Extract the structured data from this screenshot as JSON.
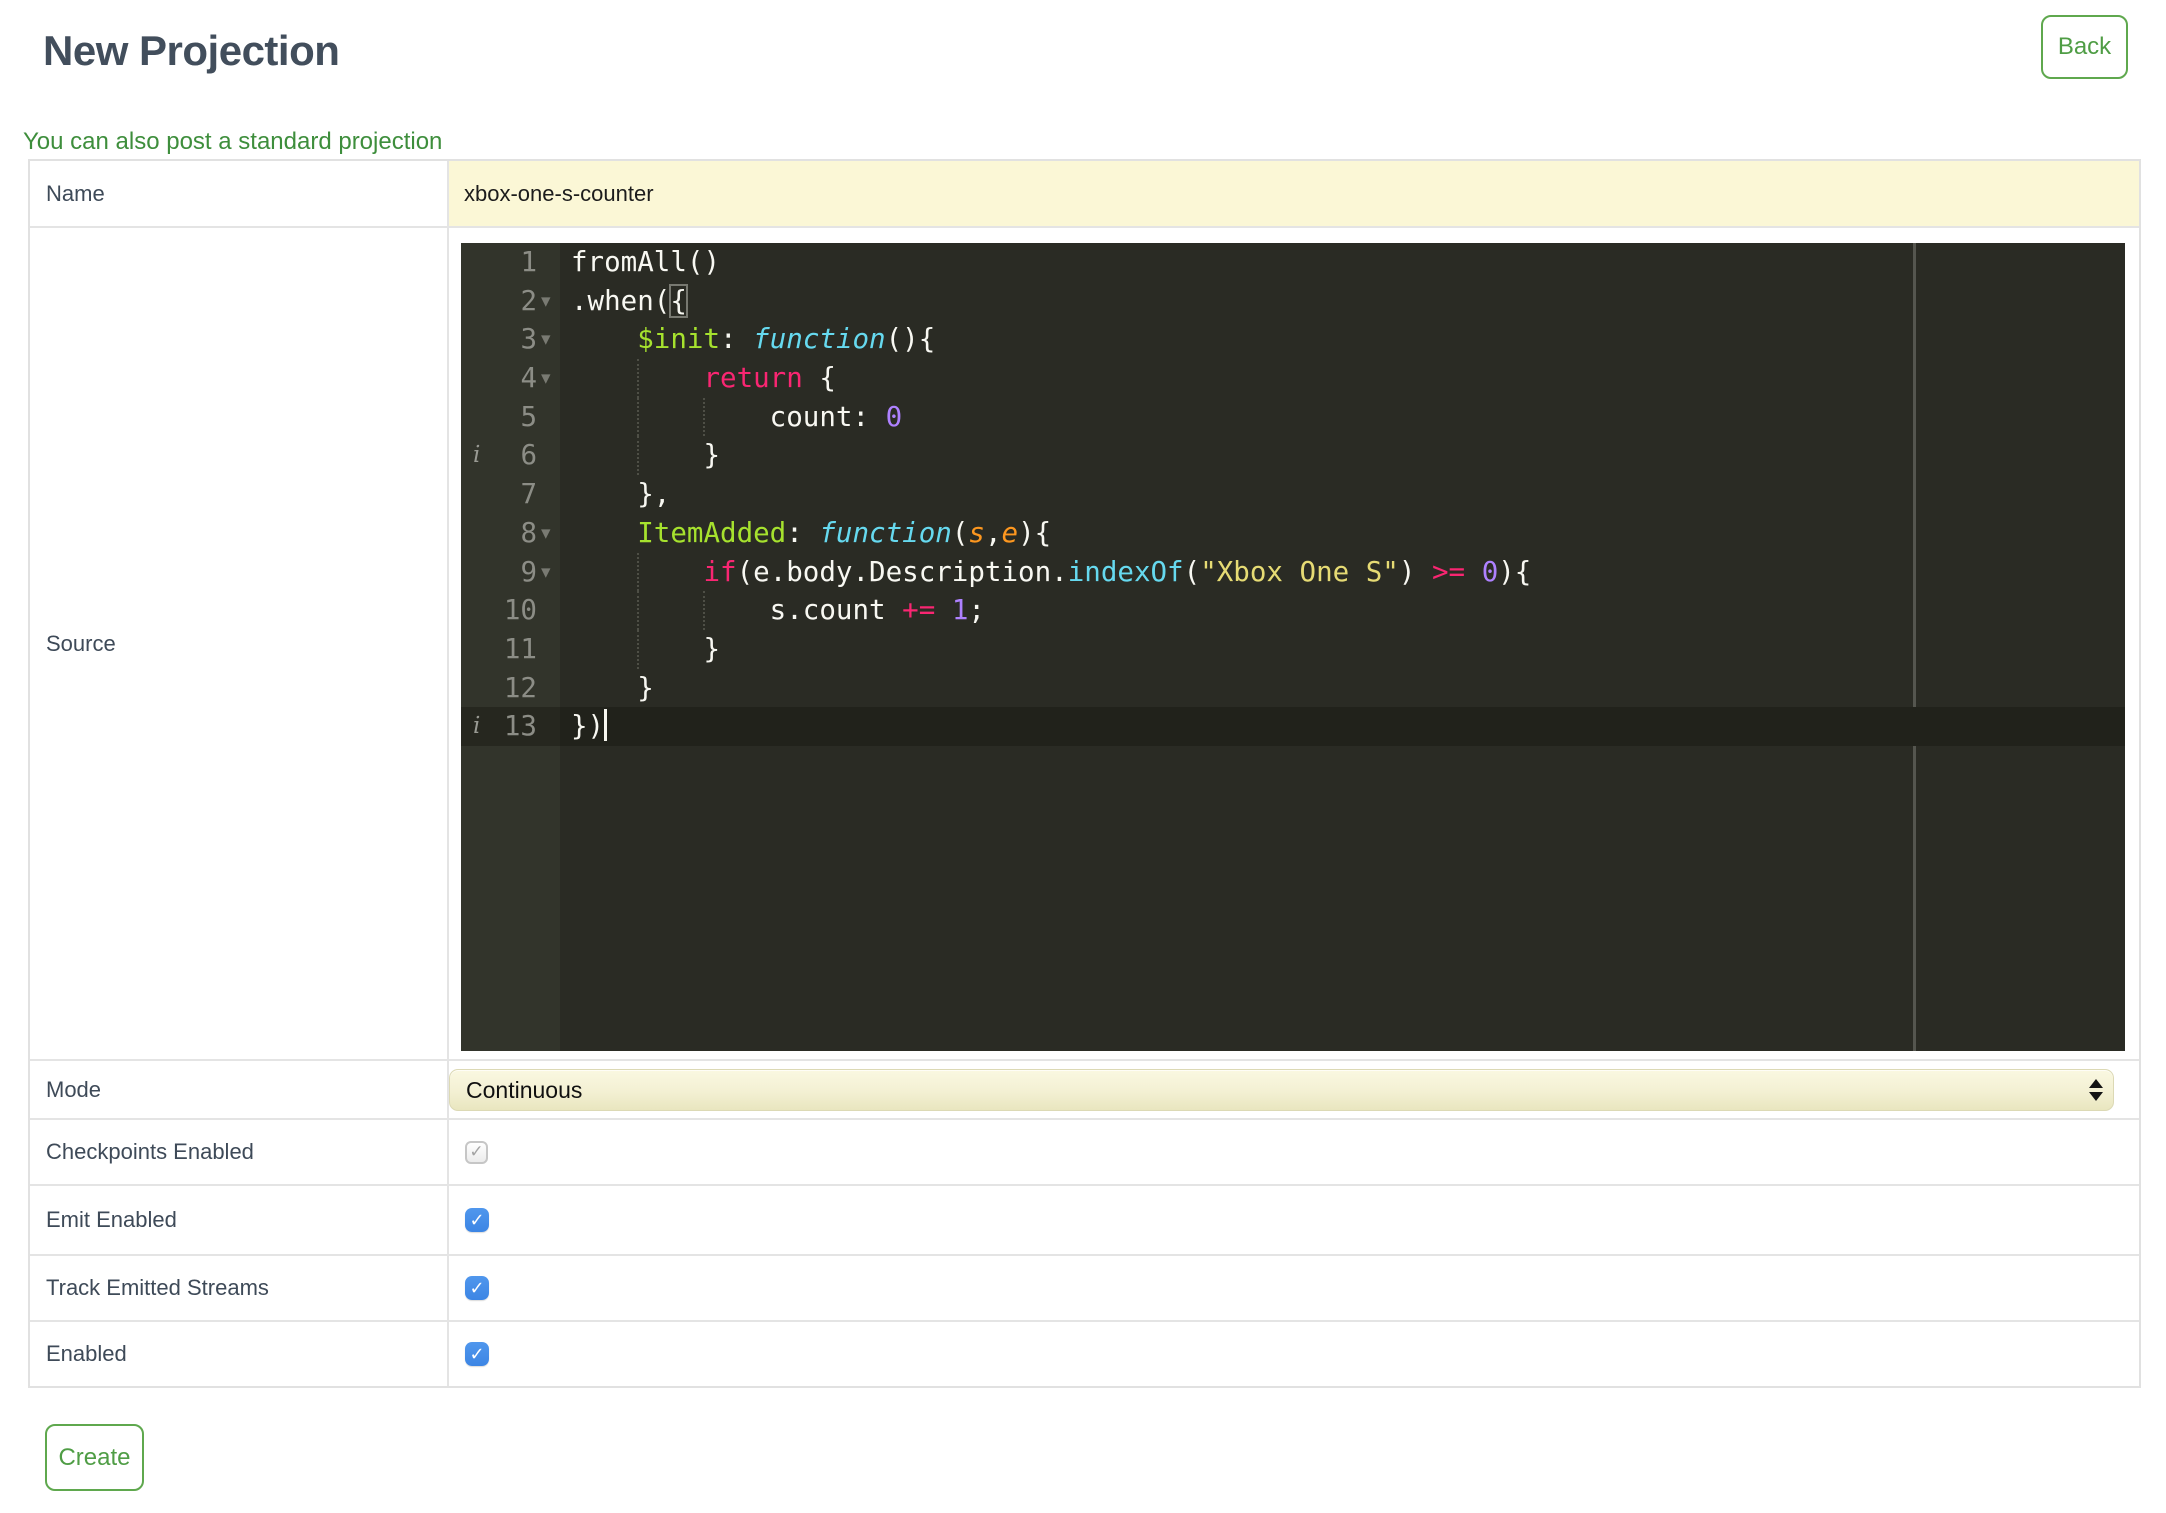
{
  "page": {
    "title": "New Projection",
    "back_label": "Back",
    "link_text": "You can also post a standard projection",
    "create_label": "Create"
  },
  "colors": {
    "accent_green": "#4f9d45",
    "link_green": "#3e8e3c",
    "title_text": "#424e5c",
    "label_text": "#3e4a58",
    "input_yellow": "#FBF7D6",
    "checkbox_blue": "#4590e8",
    "table_border": "#e4e4e4"
  },
  "form": {
    "rows": [
      {
        "label": "Name",
        "type": "text",
        "value": "xbox-one-s-counter"
      },
      {
        "label": "Source",
        "type": "code-editor"
      },
      {
        "label": "Mode",
        "type": "select",
        "value": "Continuous"
      },
      {
        "label": "Checkpoints Enabled",
        "type": "checkbox",
        "checked": true,
        "disabled": true
      },
      {
        "label": "Emit Enabled",
        "type": "checkbox",
        "checked": true,
        "disabled": false
      },
      {
        "label": "Track Emitted Streams",
        "type": "checkbox",
        "checked": true,
        "disabled": false
      },
      {
        "label": "Enabled",
        "type": "checkbox",
        "checked": true,
        "disabled": false
      }
    ]
  },
  "editor": {
    "theme": "monokai",
    "syntax_colors": {
      "background": "#2A2B24",
      "gutter_background": "#32342B",
      "gutter_text": "#8C8D86",
      "plain": "#F8F8F2",
      "keyword": "#F92672",
      "storage_function": "#66D9EF",
      "property_name": "#A6E22E",
      "support_function": "#66D9EF",
      "string": "#E6DB74",
      "number": "#AE81FF",
      "parameter": "#FD971F"
    },
    "lines": [
      {
        "n": 1,
        "segs": [
          {
            "t": "fromAll()",
            "c": "pl"
          }
        ]
      },
      {
        "n": 2,
        "fold": true,
        "segs": [
          {
            "t": ".when(",
            "c": "pl"
          },
          {
            "t": "{",
            "c": "pl bm"
          }
        ]
      },
      {
        "n": 3,
        "fold": true,
        "segs": [
          {
            "t": "    ",
            "c": "pl"
          },
          {
            "t": "$init",
            "c": "fn"
          },
          {
            "t": ": ",
            "c": "pl"
          },
          {
            "t": "function",
            "c": "st"
          },
          {
            "t": "(){",
            "c": "pl"
          }
        ]
      },
      {
        "n": 4,
        "fold": true,
        "g": [
          4
        ],
        "segs": [
          {
            "t": "        ",
            "c": "pl"
          },
          {
            "t": "return",
            "c": "kw"
          },
          {
            "t": " {",
            "c": "pl"
          }
        ]
      },
      {
        "n": 5,
        "g": [
          4,
          8
        ],
        "segs": [
          {
            "t": "            count: ",
            "c": "pl"
          },
          {
            "t": "0",
            "c": "num"
          }
        ]
      },
      {
        "n": 6,
        "info": true,
        "g": [
          4
        ],
        "segs": [
          {
            "t": "        }",
            "c": "pl"
          }
        ]
      },
      {
        "n": 7,
        "segs": [
          {
            "t": "    },",
            "c": "pl"
          }
        ]
      },
      {
        "n": 8,
        "fold": true,
        "segs": [
          {
            "t": "    ",
            "c": "pl"
          },
          {
            "t": "ItemAdded",
            "c": "fn"
          },
          {
            "t": ": ",
            "c": "pl"
          },
          {
            "t": "function",
            "c": "st"
          },
          {
            "t": "(",
            "c": "pl"
          },
          {
            "t": "s",
            "c": "prm"
          },
          {
            "t": ",",
            "c": "pl"
          },
          {
            "t": "e",
            "c": "prm"
          },
          {
            "t": "){",
            "c": "pl"
          }
        ]
      },
      {
        "n": 9,
        "fold": true,
        "g": [
          4
        ],
        "segs": [
          {
            "t": "        ",
            "c": "pl"
          },
          {
            "t": "if",
            "c": "kw"
          },
          {
            "t": "(e.body.Description.",
            "c": "pl"
          },
          {
            "t": "indexOf",
            "c": "sup"
          },
          {
            "t": "(",
            "c": "pl"
          },
          {
            "t": "\"Xbox One S\"",
            "c": "str"
          },
          {
            "t": ") ",
            "c": "pl"
          },
          {
            "t": ">=",
            "c": "kw"
          },
          {
            "t": " ",
            "c": "pl"
          },
          {
            "t": "0",
            "c": "num"
          },
          {
            "t": "){",
            "c": "pl"
          }
        ]
      },
      {
        "n": 10,
        "g": [
          4,
          8
        ],
        "segs": [
          {
            "t": "            s.count ",
            "c": "pl"
          },
          {
            "t": "+=",
            "c": "kw"
          },
          {
            "t": " ",
            "c": "pl"
          },
          {
            "t": "1",
            "c": "num"
          },
          {
            "t": ";",
            "c": "pl"
          }
        ]
      },
      {
        "n": 11,
        "g": [
          4
        ],
        "segs": [
          {
            "t": "        }",
            "c": "pl"
          }
        ]
      },
      {
        "n": 12,
        "segs": [
          {
            "t": "    }",
            "c": "pl"
          }
        ]
      },
      {
        "n": 13,
        "info": true,
        "active": true,
        "cursor": true,
        "segs": [
          {
            "t": "})",
            "c": "pl"
          }
        ]
      }
    ]
  }
}
